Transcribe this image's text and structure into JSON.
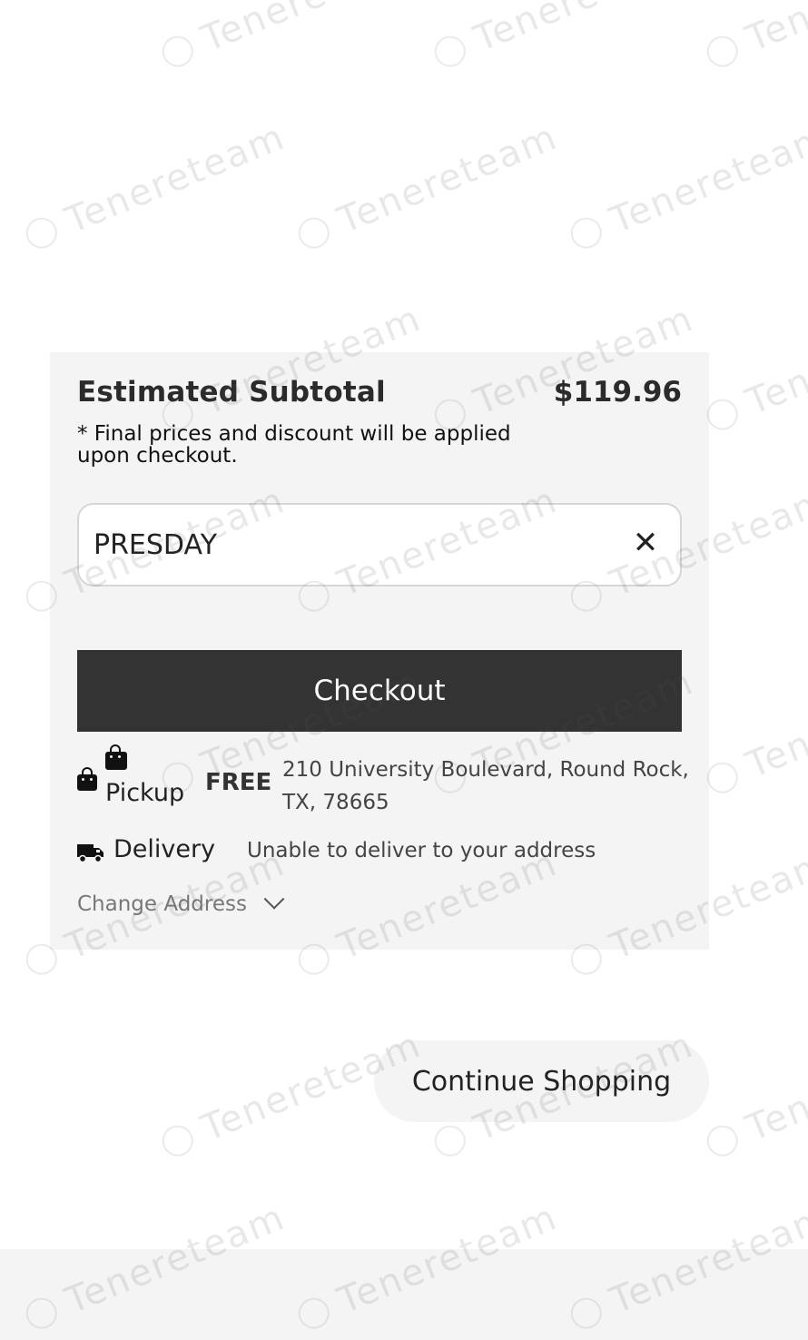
{
  "summary": {
    "subtotal_label": "Estimated Subtotal",
    "subtotal_amount": "$119.96",
    "note": "* Final prices and discount will be applied upon checkout."
  },
  "promo": {
    "value": "PRESDAY",
    "clear_icon": "close-icon",
    "clear_glyph": "✕"
  },
  "checkout": {
    "label": "Checkout"
  },
  "pickup": {
    "label": "Pickup",
    "price": "FREE",
    "address": "210 University Boulevard, Round Rock, TX, 78665",
    "icon": "shopping-bag-icon"
  },
  "delivery": {
    "label": "Delivery",
    "status": "Unable to deliver to your address",
    "icon": "truck-icon"
  },
  "change_address": {
    "label": "Change Address",
    "icon": "chevron-down-icon"
  },
  "continue_shopping": {
    "label": "Continue Shopping"
  },
  "watermark": {
    "text": "Tenereteam"
  },
  "colors": {
    "card_background": "#f4f4f4",
    "checkout_button": "#333333",
    "page_background": "#ffffff"
  }
}
